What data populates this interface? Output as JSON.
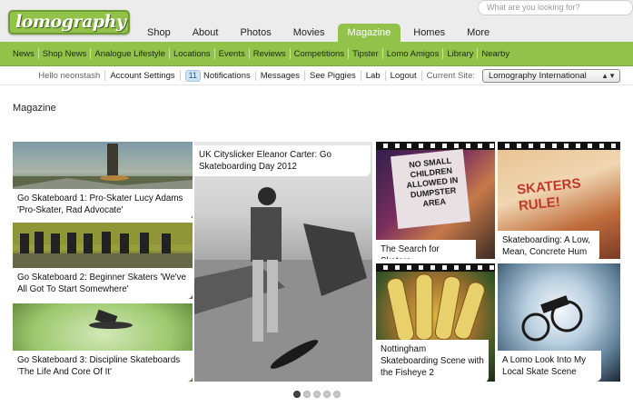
{
  "header": {
    "logo": "lomography",
    "search_placeholder": "What are you looking for?",
    "tabs": [
      {
        "label": "Shop",
        "active": false
      },
      {
        "label": "About",
        "active": false
      },
      {
        "label": "Photos",
        "active": false
      },
      {
        "label": "Movies",
        "active": false
      },
      {
        "label": "Magazine",
        "active": true
      },
      {
        "label": "Homes",
        "active": false
      },
      {
        "label": "More",
        "active": false
      }
    ]
  },
  "subnav": {
    "items": [
      "News",
      "Shop News",
      "Analogue Lifestyle",
      "Locations",
      "Events",
      "Reviews",
      "Competitions",
      "Tipster",
      "Lomo Amigos",
      "Library",
      "Nearby"
    ]
  },
  "userbar": {
    "hello": "Hello neonstash",
    "account_settings": "Account Settings",
    "notifications_count": "11",
    "notifications": "Notifications",
    "messages": "Messages",
    "see_piggies": "See Piggies",
    "lab": "Lab",
    "logout": "Logout",
    "current_site_label": "Current Site:",
    "current_site_value": "Lomography International"
  },
  "page_title": "Magazine",
  "articles": [
    {
      "caption": "Go Skateboard 1: Pro-Skater Lucy Adams 'Pro-Skater, Rad Advocate'"
    },
    {
      "caption": "Go Skateboard 2: Beginner Skaters 'We've All Got To Start Somewhere'"
    },
    {
      "caption": "Go Skateboard 3: Discipline Skateboards 'The Life And Core Of It'"
    },
    {
      "caption": "UK Cityslicker Eleanor Carter: Go Skateboarding Day 2012"
    },
    {
      "caption": "The Search for Skaters"
    },
    {
      "caption": "Skateboarding: A Low, Mean, Concrete Hum"
    },
    {
      "caption": "Nottingham Skateboarding Scene with the Fisheye 2"
    },
    {
      "caption": "A Lomo Look Into My Local Skate Scene"
    }
  ],
  "image_text": {
    "sign": "NO SMALL CHILDREN ALLOWED IN DUMPSTER AREA",
    "skaters_rule": "SKATERS RULE!"
  },
  "pager": {
    "pages": 5,
    "current": 1
  }
}
